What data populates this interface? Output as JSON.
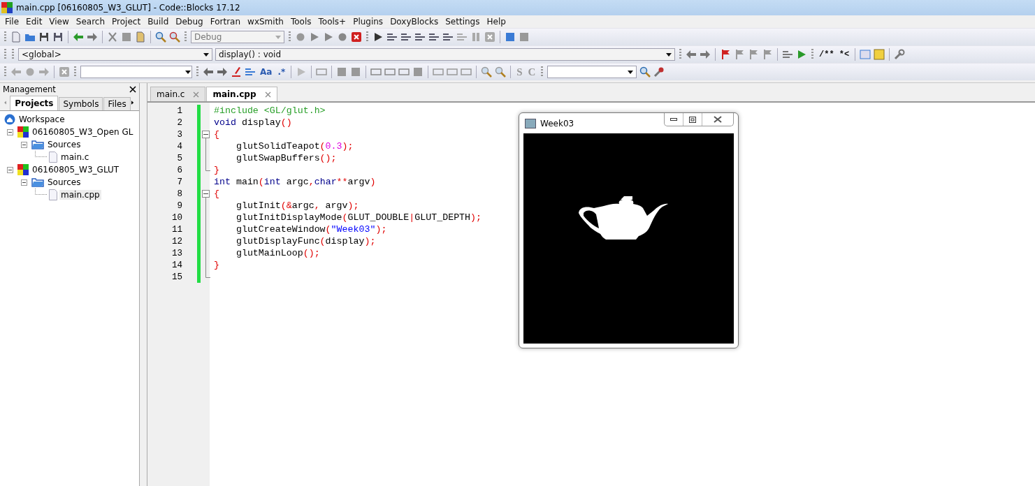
{
  "window": {
    "title": "main.cpp [06160805_W3_GLUT] - Code::Blocks 17.12"
  },
  "menu": [
    "File",
    "Edit",
    "View",
    "Search",
    "Project",
    "Build",
    "Debug",
    "Fortran",
    "wxSmith",
    "Tools",
    "Tools+",
    "Plugins",
    "DoxyBlocks",
    "Settings",
    "Help"
  ],
  "toolbar": {
    "build_target": "Debug",
    "scope": "<global>",
    "function": "display() : void",
    "doc_comment": "/** *<",
    "match_case": "Aa",
    "regex": ".*",
    "letter_buttons": [
      "S",
      "C"
    ]
  },
  "management": {
    "title": "Management",
    "tabs": [
      {
        "label": "Projects",
        "selected": true
      },
      {
        "label": "Symbols",
        "selected": false
      },
      {
        "label": "Files",
        "selected": false
      }
    ],
    "tree": [
      {
        "label": "Workspace",
        "kind": "workspace",
        "children": [
          {
            "label": "06160805_W3_Open GL",
            "kind": "project",
            "children": [
              {
                "label": "Sources",
                "kind": "folder",
                "children": [
                  {
                    "label": "main.c",
                    "kind": "file",
                    "selected": false
                  }
                ]
              }
            ]
          },
          {
            "label": "06160805_W3_GLUT",
            "kind": "project",
            "children": [
              {
                "label": "Sources",
                "kind": "folder",
                "children": [
                  {
                    "label": "main.cpp",
                    "kind": "file",
                    "selected": true
                  }
                ]
              }
            ]
          }
        ]
      }
    ]
  },
  "editor": {
    "tabs": [
      {
        "label": "main.c",
        "selected": false
      },
      {
        "label": "main.cpp",
        "selected": true
      }
    ],
    "lines": [
      {
        "number": "1",
        "kind": "plain",
        "tokens": [
          {
            "kind": "pre",
            "text": "#include <GL/glut.h>"
          }
        ]
      },
      {
        "number": "2",
        "kind": "plain",
        "tokens": [
          {
            "kind": "kw",
            "text": "void"
          },
          {
            "kind": "id",
            "text": " display"
          },
          {
            "kind": "op",
            "text": "()"
          }
        ]
      },
      {
        "number": "3",
        "kind": "opener",
        "tokens": [
          {
            "kind": "op",
            "text": "{"
          }
        ]
      },
      {
        "number": "4",
        "kind": "inner",
        "tokens": [
          {
            "kind": "id",
            "text": "    glutSolidTeapot"
          },
          {
            "kind": "op",
            "text": "("
          },
          {
            "kind": "num",
            "text": "0.3"
          },
          {
            "kind": "op",
            "text": ");"
          }
        ]
      },
      {
        "number": "5",
        "kind": "inner",
        "tokens": [
          {
            "kind": "id",
            "text": "    glutSwapBuffers"
          },
          {
            "kind": "op",
            "text": "();"
          }
        ]
      },
      {
        "number": "6",
        "kind": "closer",
        "tokens": [
          {
            "kind": "op",
            "text": "}"
          }
        ]
      },
      {
        "number": "7",
        "kind": "plain",
        "tokens": [
          {
            "kind": "kw",
            "text": "int"
          },
          {
            "kind": "id",
            "text": " main"
          },
          {
            "kind": "op",
            "text": "("
          },
          {
            "kind": "kw",
            "text": "int"
          },
          {
            "kind": "id",
            "text": " argc"
          },
          {
            "kind": "op",
            "text": ","
          },
          {
            "kind": "kw",
            "text": "char"
          },
          {
            "kind": "op",
            "text": "**"
          },
          {
            "kind": "id",
            "text": "argv"
          },
          {
            "kind": "op",
            "text": ")"
          }
        ]
      },
      {
        "number": "8",
        "kind": "opener",
        "tokens": [
          {
            "kind": "op",
            "text": "{"
          }
        ]
      },
      {
        "number": "9",
        "kind": "inner",
        "tokens": [
          {
            "kind": "id",
            "text": "    glutInit"
          },
          {
            "kind": "op",
            "text": "(&"
          },
          {
            "kind": "id",
            "text": "argc"
          },
          {
            "kind": "op",
            "text": ","
          },
          {
            "kind": "id",
            "text": " argv"
          },
          {
            "kind": "op",
            "text": ");"
          }
        ]
      },
      {
        "number": "10",
        "kind": "inner",
        "tokens": [
          {
            "kind": "id",
            "text": "    glutInitDisplayMode"
          },
          {
            "kind": "op",
            "text": "("
          },
          {
            "kind": "id",
            "text": "GLUT_DOUBLE"
          },
          {
            "kind": "op",
            "text": "|"
          },
          {
            "kind": "id",
            "text": "GLUT_DEPTH"
          },
          {
            "kind": "op",
            "text": ");"
          }
        ]
      },
      {
        "number": "11",
        "kind": "inner",
        "tokens": [
          {
            "kind": "id",
            "text": "    glutCreateWindow"
          },
          {
            "kind": "op",
            "text": "("
          },
          {
            "kind": "str",
            "text": "\"Week03\""
          },
          {
            "kind": "op",
            "text": ");"
          }
        ]
      },
      {
        "number": "12",
        "kind": "inner",
        "tokens": [
          {
            "kind": "id",
            "text": "    glutDisplayFunc"
          },
          {
            "kind": "op",
            "text": "("
          },
          {
            "kind": "id",
            "text": "display"
          },
          {
            "kind": "op",
            "text": ");"
          }
        ]
      },
      {
        "number": "13",
        "kind": "inner",
        "tokens": [
          {
            "kind": "id",
            "text": "    glutMainLoop"
          },
          {
            "kind": "op",
            "text": "();"
          }
        ]
      },
      {
        "number": "14",
        "kind": "inner",
        "tokens": [
          {
            "kind": "op",
            "text": "}"
          }
        ]
      },
      {
        "number": "15",
        "kind": "closer"
      }
    ]
  },
  "glut_window": {
    "title": "Week03"
  }
}
